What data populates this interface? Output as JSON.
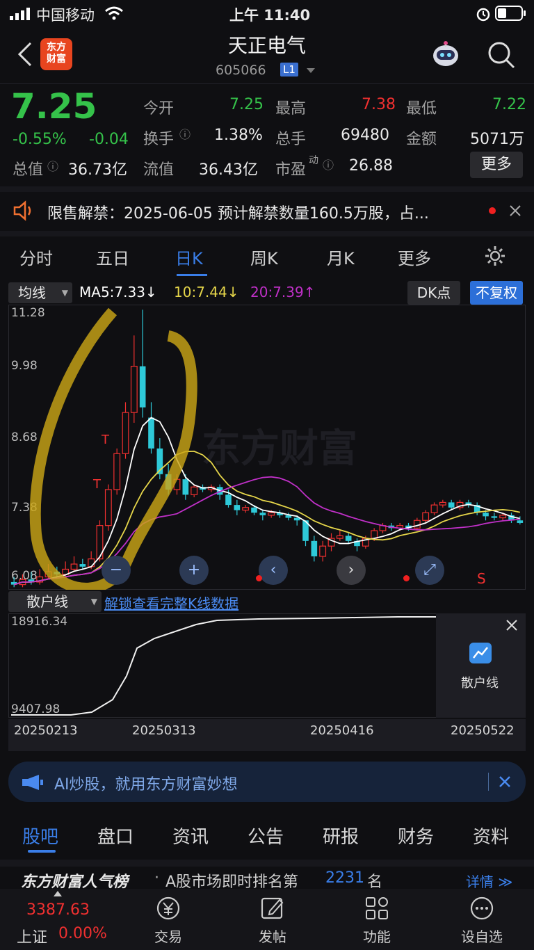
{
  "status_bar": {
    "carrier": "中国移动",
    "time": "上午 11:40"
  },
  "header": {
    "title": "天正电气",
    "code": "605066",
    "level_badge": "L1",
    "logo_line1": "东方",
    "logo_line2": "财富"
  },
  "quote": {
    "price": "7.25",
    "change_pct": "-0.55%",
    "change": "-0.04",
    "open_label": "今开",
    "open": "7.25",
    "high_label": "最高",
    "high": "7.38",
    "low_label": "最低",
    "low": "7.22",
    "turnover_label": "换手",
    "turnover": "1.38%",
    "volume_label": "总手",
    "volume": "69480",
    "amount_label": "金额",
    "amount": "5071万",
    "total_mv_label": "总值",
    "total_mv": "36.73亿",
    "float_mv_label": "流值",
    "float_mv": "36.43亿",
    "pe_label": "市盈",
    "pe_sup": "动",
    "pe": "26.88",
    "more_button": "更多"
  },
  "notice": {
    "text": "限售解禁：2025-06-05 预计解禁数量160.5万股，占..."
  },
  "period_tabs": [
    "分时",
    "五日",
    "日K",
    "周K",
    "月K",
    "更多"
  ],
  "chart_toolbar": {
    "indicator_select": "均线",
    "ma5": "MA5:7.33↓",
    "ma10": "10:7.44↓",
    "ma20": "20:7.39↑",
    "dk_button": "DK点",
    "adjust_button": "不复权",
    "watermark": "东方财富"
  },
  "chart_y_labels": [
    "11.28",
    "9.98",
    "8.68",
    "7.38",
    "6.08"
  ],
  "chart_marks": {
    "t1": "T",
    "t2": "T",
    "s1": "S"
  },
  "sub_chart": {
    "indicator_select": "散户线",
    "unlock_link": "解锁查看完整K线数据",
    "y_top": "18916.34",
    "y_bottom": "9407.98",
    "panel_label": "散户线"
  },
  "x_dates": [
    "20250213",
    "20250313",
    "20250416",
    "20250522"
  ],
  "ai_banner": {
    "text": "AI炒股，就用东方财富妙想"
  },
  "bottom_tabs": [
    "股吧",
    "盘口",
    "资讯",
    "公告",
    "研报",
    "财务",
    "资料"
  ],
  "rank": {
    "brand": "东方财富人气榜",
    "text": "A股市场即时排名第",
    "rank": "2231",
    "suffix": "名",
    "detail": "详情"
  },
  "bottom_nav": {
    "index_value": "3387.63",
    "index_name": "上证",
    "index_change": "0.00%",
    "items": [
      "交易",
      "发帖",
      "功能",
      "设自选"
    ]
  },
  "colors": {
    "up": "#f03030",
    "down": "#35c24a",
    "accent": "#3a7ee8",
    "candle_down": "#2ec9d8",
    "ma5": "#ffffff",
    "ma10": "#e6d64a",
    "ma20": "#c030c8"
  }
}
